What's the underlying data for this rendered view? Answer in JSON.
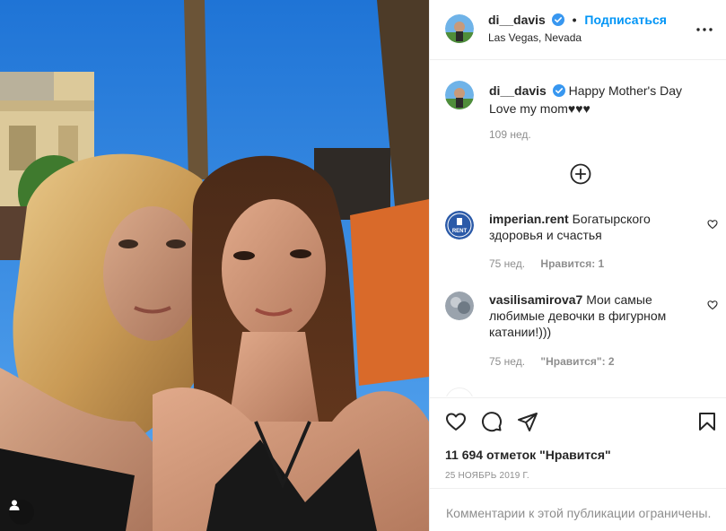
{
  "post": {
    "username": "di__davis",
    "follow_label": "Подписаться",
    "separator": "•",
    "location": "Las Vegas, Nevada",
    "verified_icon": "verified-badge-icon",
    "caption_username": "di__davis",
    "caption_text": "Happy Mother's Day Love my mom♥♥♥",
    "caption_time": "109 нед.",
    "load_more_icon": "plus-circle-icon"
  },
  "comments": [
    {
      "username": "imperian.rent",
      "text": "Богатырского здоровья и счастья",
      "time": "75 нед.",
      "likes": "Нравится: 1",
      "avatar_label": "RENT"
    },
    {
      "username": "vasilisamirova7",
      "text": "Мои самые любимые девочки в фигурном катании!)))",
      "time": "75 нед.",
      "likes": "\"Нравится\": 2"
    }
  ],
  "actions": {
    "like_icon": "heart-icon",
    "comment_icon": "comment-icon",
    "share_icon": "paper-plane-icon",
    "save_icon": "bookmark-icon",
    "like_count": "11 694 отметок \"Нравится\"",
    "date": "25 НОЯБРЬ 2019 Г.",
    "restricted_text": "Комментарии к этой публикации ограничены."
  },
  "colors": {
    "link_blue": "#0095f6",
    "text": "#262626",
    "secondary": "#8e8e8e",
    "border": "#efefef"
  }
}
